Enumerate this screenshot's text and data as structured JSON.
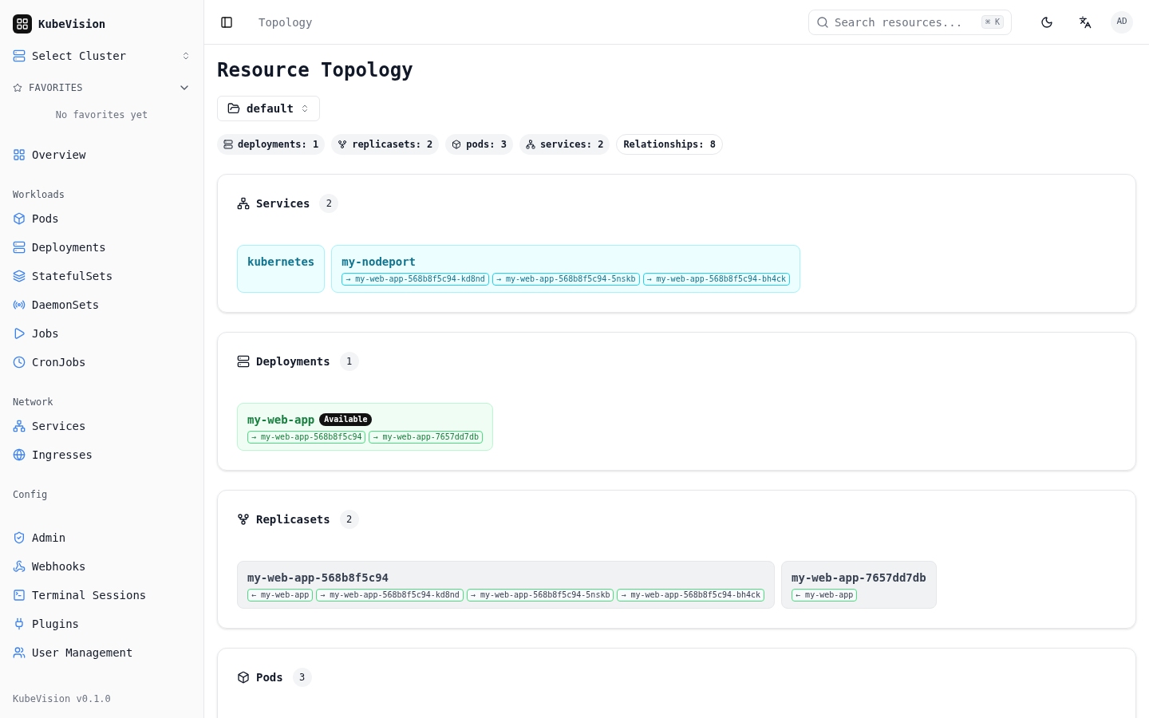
{
  "app": {
    "name": "KubeVision",
    "cluster_select": "Select Cluster",
    "favorites_title": "FAVORITES",
    "favorites_empty": "No favorites yet",
    "version": "KubeVision v0.1.0"
  },
  "sidebar": {
    "top": [
      {
        "label": "Overview",
        "kind": "grid"
      }
    ],
    "groups": [
      {
        "title": "Workloads",
        "items": [
          {
            "label": "Pods",
            "kind": "box"
          },
          {
            "label": "Deployments",
            "kind": "server"
          },
          {
            "label": "StatefulSets",
            "kind": "layers"
          },
          {
            "label": "DaemonSets",
            "kind": "radio"
          },
          {
            "label": "Jobs",
            "kind": "play"
          },
          {
            "label": "CronJobs",
            "kind": "clock"
          }
        ]
      },
      {
        "title": "Network",
        "items": [
          {
            "label": "Services",
            "kind": "network"
          },
          {
            "label": "Ingresses",
            "kind": "globe"
          }
        ]
      },
      {
        "title": "Config",
        "items": [
          {
            "label": "Admin",
            "kind": "shield"
          },
          {
            "label": "Webhooks",
            "kind": "webhook"
          },
          {
            "label": "Terminal Sessions",
            "kind": "terminal"
          },
          {
            "label": "Plugins",
            "kind": "plug"
          },
          {
            "label": "User Management",
            "kind": "users"
          }
        ]
      }
    ]
  },
  "header": {
    "breadcrumb": "Topology",
    "search_placeholder": "Search resources...",
    "shortcut": "⌘ K",
    "avatar": "AD"
  },
  "page": {
    "title": "Resource Topology",
    "namespace": "default"
  },
  "stats": [
    {
      "kind": "deployments",
      "label": "deployments: 1"
    },
    {
      "kind": "replicasets",
      "label": "replicasets: 2"
    },
    {
      "kind": "pods",
      "label": "pods: 3"
    },
    {
      "kind": "services",
      "label": "services: 2"
    },
    {
      "kind": "total",
      "label": "Relationships: 8"
    }
  ],
  "sections": [
    {
      "kind": "services",
      "title": "Services",
      "count": "2",
      "items": [
        {
          "name": "kubernetes"
        },
        {
          "name": "my-nodeport",
          "links": [
            "→ my-web-app-568b8f5c94-kd8nd",
            "→ my-web-app-568b8f5c94-5nskb",
            "→ my-web-app-568b8f5c94-bh4ck"
          ]
        }
      ]
    },
    {
      "kind": "deployments",
      "title": "Deployments",
      "count": "1",
      "items": [
        {
          "name": "my-web-app",
          "badge": "Available",
          "links": [
            "→ my-web-app-568b8f5c94",
            "→ my-web-app-7657dd7db"
          ]
        }
      ]
    },
    {
      "kind": "replicasets",
      "title": "Replicasets",
      "count": "2",
      "items": [
        {
          "name": "my-web-app-568b8f5c94",
          "links": [
            "← my-web-app",
            "→ my-web-app-568b8f5c94-kd8nd",
            "→ my-web-app-568b8f5c94-5nskb",
            "→ my-web-app-568b8f5c94-bh4ck"
          ]
        },
        {
          "name": "my-web-app-7657dd7db",
          "links": [
            "← my-web-app"
          ]
        }
      ]
    },
    {
      "kind": "pods",
      "title": "Pods",
      "count": "3"
    }
  ]
}
